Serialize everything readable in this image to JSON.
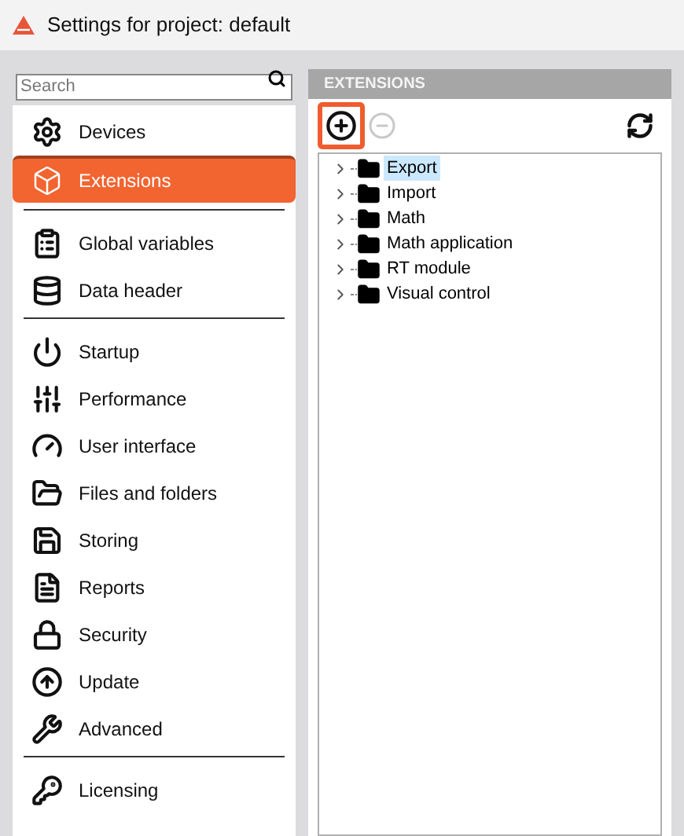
{
  "window": {
    "title": "Settings for project: default"
  },
  "search": {
    "placeholder": "Search"
  },
  "sidebar": {
    "groups": [
      [
        {
          "label": "Devices",
          "selected": false
        },
        {
          "label": "Extensions",
          "selected": true
        }
      ],
      [
        {
          "label": "Global variables",
          "selected": false
        },
        {
          "label": "Data header",
          "selected": false
        }
      ],
      [
        {
          "label": "Startup",
          "selected": false
        },
        {
          "label": "Performance",
          "selected": false
        },
        {
          "label": "User interface",
          "selected": false
        },
        {
          "label": "Files and folders",
          "selected": false
        },
        {
          "label": "Storing",
          "selected": false
        },
        {
          "label": "Reports",
          "selected": false
        },
        {
          "label": "Security",
          "selected": false
        },
        {
          "label": "Update",
          "selected": false
        },
        {
          "label": "Advanced",
          "selected": false
        }
      ],
      [
        {
          "label": "Licensing",
          "selected": false
        }
      ]
    ]
  },
  "panel": {
    "title": "EXTENSIONS",
    "toolbar": {
      "add": {
        "highlighted": true
      },
      "remove": {
        "disabled": true
      }
    },
    "tree": [
      {
        "label": "Export",
        "selected": true,
        "expanded": false
      },
      {
        "label": "Import",
        "selected": false,
        "expanded": false
      },
      {
        "label": "Math",
        "selected": false,
        "expanded": false
      },
      {
        "label": "Math application",
        "selected": false,
        "expanded": false
      },
      {
        "label": "RT module",
        "selected": false,
        "expanded": false
      },
      {
        "label": "Visual control",
        "selected": false,
        "expanded": false
      }
    ]
  }
}
